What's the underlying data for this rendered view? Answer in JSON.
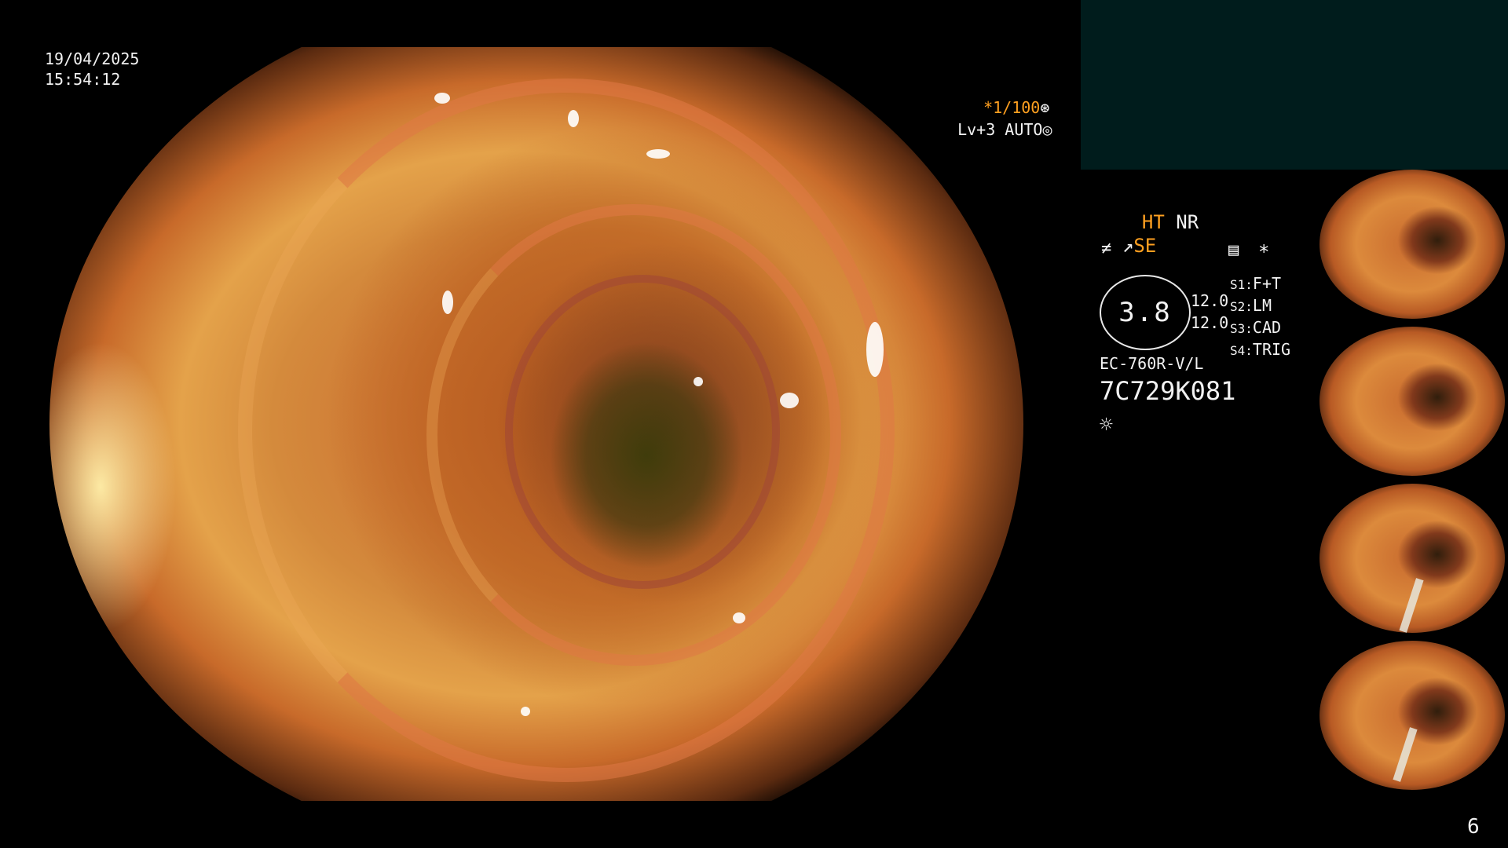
{
  "datetime": {
    "date": "19/04/2025",
    "time": "15:54:12"
  },
  "exposure": {
    "shutter": "*1/100",
    "shutter_icon": "aperture-icon",
    "level": "Lv+3 AUTO",
    "level_icon": "iris-icon"
  },
  "enhancement": {
    "ht": "HT",
    "nr": "NR",
    "se": "SE",
    "se_icon": "scope-icon",
    "freeze_icon": "freeze-icon"
  },
  "status": {
    "menu_icon": "menu-icon",
    "asterisk": "*"
  },
  "zoom": {
    "value": "3.8",
    "side_a": "12.0",
    "side_b": "12.0"
  },
  "switches": [
    {
      "key": "S1:",
      "value": "F+T"
    },
    {
      "key": "S2:",
      "value": "LM"
    },
    {
      "key": "S3:",
      "value": "CAD"
    },
    {
      "key": "S4:",
      "value": "TRIG"
    }
  ],
  "scope": {
    "model": "EC-760R-V/L",
    "serial": "7C729K081",
    "light_icon": "light-icon"
  },
  "page_number": "6",
  "colors": {
    "accent": "#ffa020",
    "panel": "#001c1c",
    "text": "#f2f2f2"
  }
}
